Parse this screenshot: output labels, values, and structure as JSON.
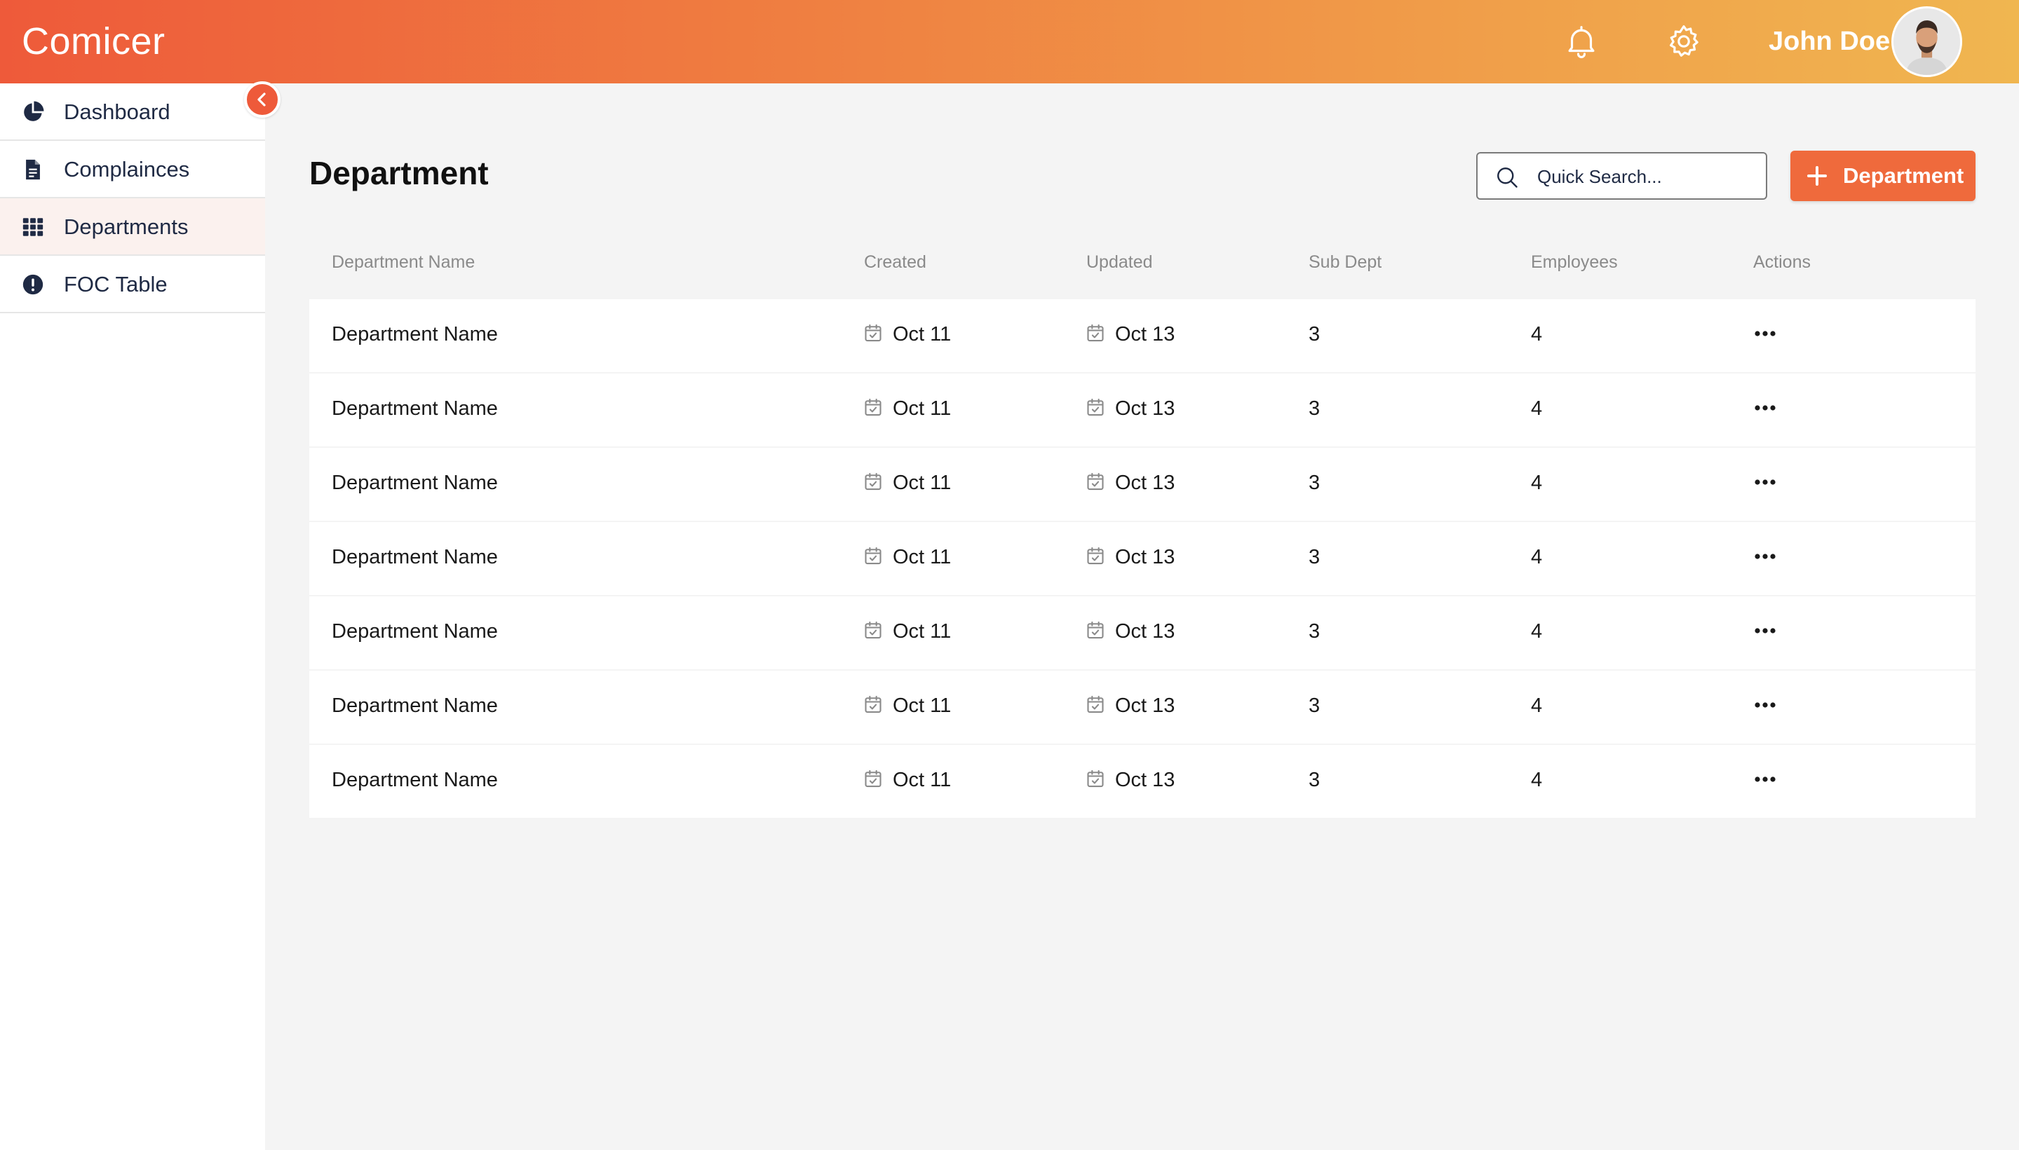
{
  "app": {
    "brand": "Comicer"
  },
  "header": {
    "username": "John Doe",
    "notifications_icon": "bell-icon",
    "settings_icon": "gear-icon"
  },
  "sidebar": {
    "items": [
      {
        "label": "Dashboard",
        "icon": "pie-chart-icon",
        "active": false
      },
      {
        "label": "Complainces",
        "icon": "document-icon",
        "active": false
      },
      {
        "label": "Departments",
        "icon": "grid-icon",
        "active": true
      },
      {
        "label": "FOC Table",
        "icon": "alert-icon",
        "active": false
      }
    ]
  },
  "page": {
    "title": "Department",
    "search_placeholder": "Quick Search...",
    "add_button_label": "Department"
  },
  "table": {
    "headers": [
      "Department Name",
      "Created",
      "Updated",
      "Sub Dept",
      "Employees",
      "Actions"
    ],
    "rows": [
      {
        "name": "Department Name",
        "created": "Oct 11",
        "updated": "Oct 13",
        "sub_dept": "3",
        "employees": "4"
      },
      {
        "name": "Department Name",
        "created": "Oct 11",
        "updated": "Oct 13",
        "sub_dept": "3",
        "employees": "4"
      },
      {
        "name": "Department Name",
        "created": "Oct 11",
        "updated": "Oct 13",
        "sub_dept": "3",
        "employees": "4"
      },
      {
        "name": "Department Name",
        "created": "Oct 11",
        "updated": "Oct 13",
        "sub_dept": "3",
        "employees": "4"
      },
      {
        "name": "Department Name",
        "created": "Oct 11",
        "updated": "Oct 13",
        "sub_dept": "3",
        "employees": "4"
      },
      {
        "name": "Department Name",
        "created": "Oct 11",
        "updated": "Oct 13",
        "sub_dept": "3",
        "employees": "4"
      },
      {
        "name": "Department Name",
        "created": "Oct 11",
        "updated": "Oct 13",
        "sub_dept": "3",
        "employees": "4"
      }
    ]
  },
  "colors": {
    "accent": "#ee5a3a",
    "header_gradient_start": "#ee5a3a",
    "header_gradient_end": "#f0b650",
    "button": "#ef6a3c"
  }
}
